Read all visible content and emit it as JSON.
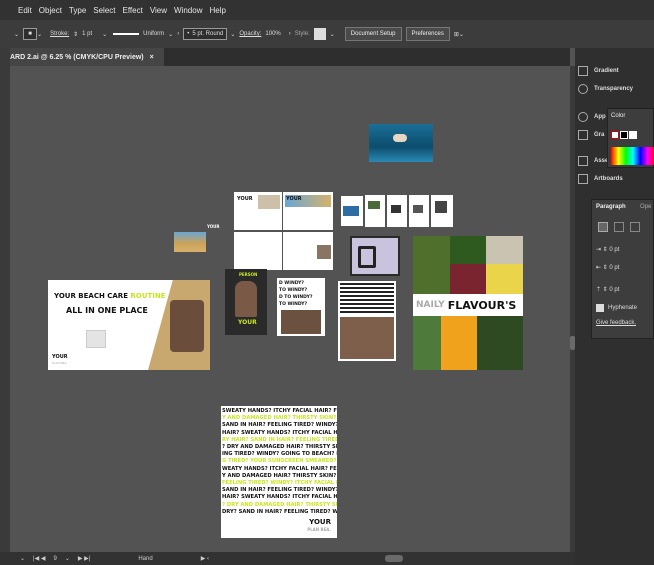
{
  "menu": [
    "Edit",
    "Object",
    "Type",
    "Select",
    "Effect",
    "View",
    "Window",
    "Help"
  ],
  "control": {
    "stroke_label": "Stroke:",
    "stroke_value": "1 pt",
    "profile": "Uniform",
    "brush": "5 pt. Round",
    "opacity_label": "Opacity:",
    "opacity_value": "100%",
    "style_label": "Style:",
    "document_setup": "Document Setup",
    "preferences": "Preferences"
  },
  "tab": {
    "title": "ARD 2.ai @ 6.25 % (CMYK/CPU Preview)",
    "close": "×"
  },
  "status": {
    "page": "9",
    "tool": "Hand"
  },
  "panels": {
    "gradient": "Gradient",
    "transparency": "Transparency",
    "appearance": "App",
    "graphic": "Gra",
    "asset": "Asse",
    "artboards": "Artboards",
    "color": "Color",
    "paragraph": "Paragraph",
    "open": "Ope",
    "indent_1": "0 pt",
    "indent_2": "0 pt",
    "indent_3": "0 pt",
    "hyphenate": "Hyphenate",
    "feedback": "Give feedback."
  },
  "artboards": {
    "beach_title": "YOUR BEACH CARE",
    "beach_title_accent": "ROUTINE",
    "beach_sub": "ALL IN ONE PLACE",
    "your": "YOUR",
    "plan_bea": "PLAN BEA.",
    "flavour_title": "FLAVOUR'S",
    "flavour_prefix": "NAILY",
    "poster_lines": [
      "SWEATY HANDS? ITCHY FACIAL HAIR? FEELING DRY? FE",
      "Y AND DAMAGED HAIR? THIRSTY SKIN? FEELING OF STI",
      "SAND IN HAIR? FEELING TIRED? WINDY? GOING TO BEACH",
      "HAIR? SWEATY HANDS? ITCHY FACIAL HAIR? FEELING D",
      "RY HAIR? SAND IN HAIR? FEELING TIRED? WINDY? GOI",
      "? DRY AND DAMAGED HAIR? THIRSTY SKIN? FEELING OF",
      "ING TIRED? WINDY? GOING TO BEACH? ITCHY FACIAL",
      "G TIRED? YOUR SUNSCREEN SMEARED? SAND IN HAIR",
      "WEATY HANDS? ITCHY FACIAL HAIR? FEELING DRY? FEE",
      "Y AND DAMAGED HAIR? THIRSTY SKIN? FEELING OF STI",
      "FEELING TIRED? WINDY? ITCHY FACIAL HAIR? BE STE",
      "SAND IN HAIR? FEELING TIRED? WINDY? GOING TO BEACH?",
      "HAIR? SWEATY HANDS? ITCHY FACIAL HAIR? FEELING",
      "? DRY AND DAMAGED HAIR? THIRSTY SKIN? FEELING OF",
      "DRY? SAND IN HAIR? FEELING TIRED? WINDY? GOING TO B"
    ],
    "poster_brand": "YOUR",
    "poster_brand_sub": "PLAN BEA.",
    "windy_lines": [
      "D WINDY?",
      "TO WINDY?",
      "D TO WINDY?",
      "TO WINDY?"
    ],
    "person_label": "PERSON"
  },
  "colors": {
    "accent_lime": "#c8e620",
    "canvas": "#535353",
    "panel": "#2f2f2f"
  }
}
